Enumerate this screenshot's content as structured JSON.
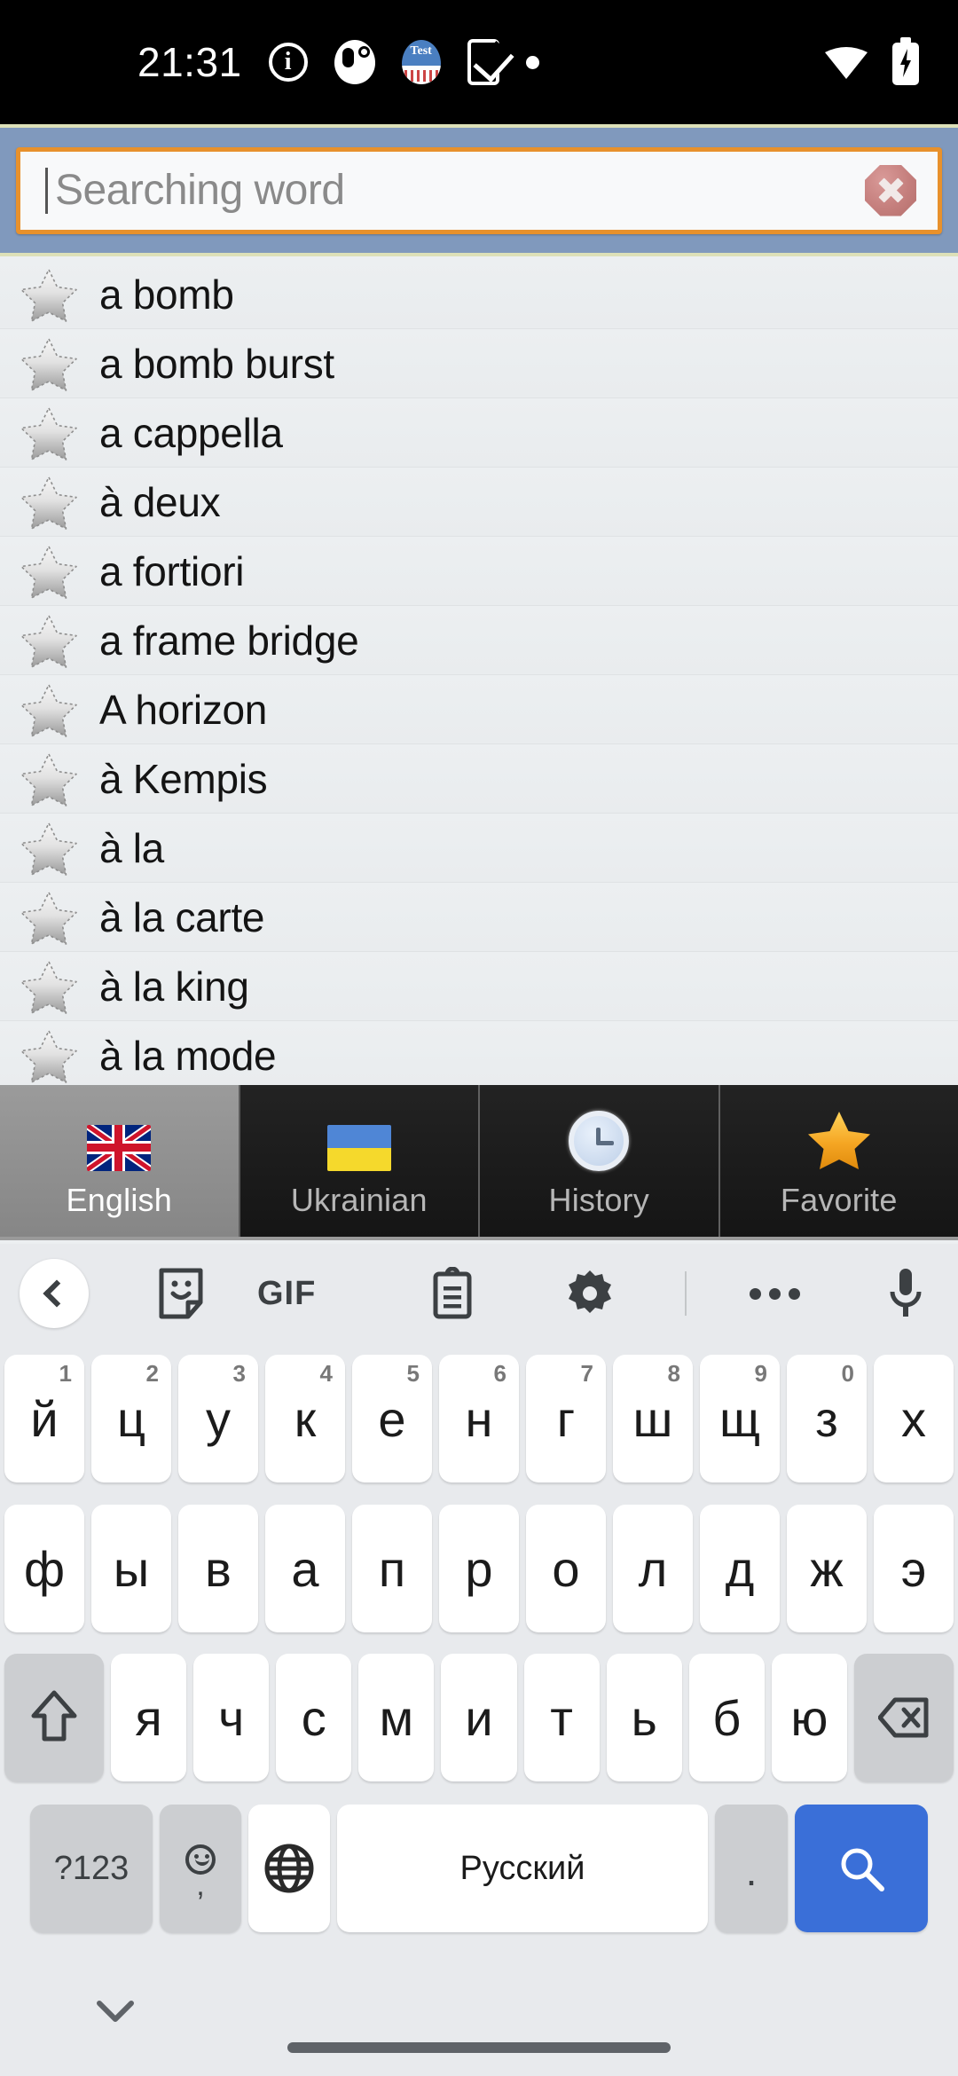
{
  "status_bar": {
    "time": "21:31",
    "left_icons": [
      "info-icon",
      "notification-blob-icon",
      "test-app-icon",
      "phone-check-icon",
      "dot-icon"
    ],
    "right_icons": [
      "wifi-icon",
      "battery-charging-icon"
    ],
    "test_app_label": "Test"
  },
  "search": {
    "placeholder": "Searching word",
    "value": "",
    "clear_icon": "clear-octagon-icon",
    "bar_color": "#8099bd",
    "field_border_color": "#e8912c"
  },
  "word_list": {
    "items": [
      {
        "word": "a bomb",
        "favorite_icon": "star-outline-icon"
      },
      {
        "word": "a bomb burst",
        "favorite_icon": "star-outline-icon"
      },
      {
        "word": "a cappella",
        "favorite_icon": "star-outline-icon"
      },
      {
        "word": "à deux",
        "favorite_icon": "star-outline-icon"
      },
      {
        "word": "a fortiori",
        "favorite_icon": "star-outline-icon"
      },
      {
        "word": "a frame bridge",
        "favorite_icon": "star-outline-icon"
      },
      {
        "word": "A horizon",
        "favorite_icon": "star-outline-icon"
      },
      {
        "word": "à Kempis",
        "favorite_icon": "star-outline-icon"
      },
      {
        "word": "à la",
        "favorite_icon": "star-outline-icon"
      },
      {
        "word": "à la carte",
        "favorite_icon": "star-outline-icon"
      },
      {
        "word": "à la king",
        "favorite_icon": "star-outline-icon"
      },
      {
        "word": "à la mode",
        "favorite_icon": "star-outline-icon"
      }
    ]
  },
  "tabs": [
    {
      "label": "English",
      "icon": "uk-flag-icon",
      "selected": true
    },
    {
      "label": "Ukrainian",
      "icon": "ukraine-flag-icon",
      "selected": false
    },
    {
      "label": "History",
      "icon": "clock-icon",
      "selected": false
    },
    {
      "label": "Favorite",
      "icon": "gold-star-icon",
      "selected": false
    }
  ],
  "keyboard": {
    "toolbar": [
      {
        "name": "back-icon",
        "label": ""
      },
      {
        "name": "sticker-icon",
        "label": ""
      },
      {
        "name": "gif-icon",
        "label": "GIF"
      },
      {
        "name": "clipboard-icon",
        "label": ""
      },
      {
        "name": "gear-icon",
        "label": ""
      },
      {
        "name": "more-icon",
        "label": ""
      },
      {
        "name": "microphone-icon",
        "label": ""
      }
    ],
    "row1": [
      {
        "key": "й",
        "num": "1"
      },
      {
        "key": "ц",
        "num": "2"
      },
      {
        "key": "у",
        "num": "3"
      },
      {
        "key": "к",
        "num": "4"
      },
      {
        "key": "е",
        "num": "5"
      },
      {
        "key": "н",
        "num": "6"
      },
      {
        "key": "г",
        "num": "7"
      },
      {
        "key": "ш",
        "num": "8"
      },
      {
        "key": "щ",
        "num": "9"
      },
      {
        "key": "з",
        "num": "0"
      },
      {
        "key": "х",
        "num": ""
      }
    ],
    "row2": [
      {
        "key": "ф"
      },
      {
        "key": "ы"
      },
      {
        "key": "в"
      },
      {
        "key": "а"
      },
      {
        "key": "п"
      },
      {
        "key": "р"
      },
      {
        "key": "о"
      },
      {
        "key": "л"
      },
      {
        "key": "д"
      },
      {
        "key": "ж"
      },
      {
        "key": "э"
      }
    ],
    "row3": {
      "shift_icon": "shift-icon",
      "letters": [
        {
          "key": "я"
        },
        {
          "key": "ч"
        },
        {
          "key": "с"
        },
        {
          "key": "м"
        },
        {
          "key": "и"
        },
        {
          "key": "т"
        },
        {
          "key": "ь"
        },
        {
          "key": "б"
        },
        {
          "key": "ю"
        }
      ],
      "backspace_icon": "backspace-icon"
    },
    "row4": {
      "symbols_label": "?123",
      "comma_label": ",",
      "emoji_icon": "emoji-icon",
      "globe_icon": "globe-icon",
      "space_label": "Русский",
      "period_label": ".",
      "search_icon": "search-icon",
      "enter_color": "#3a6fd8"
    }
  },
  "bottom_nav": {
    "hide_keyboard_icon": "chevron-down-icon",
    "gesture_bar": "home-gesture-bar"
  }
}
